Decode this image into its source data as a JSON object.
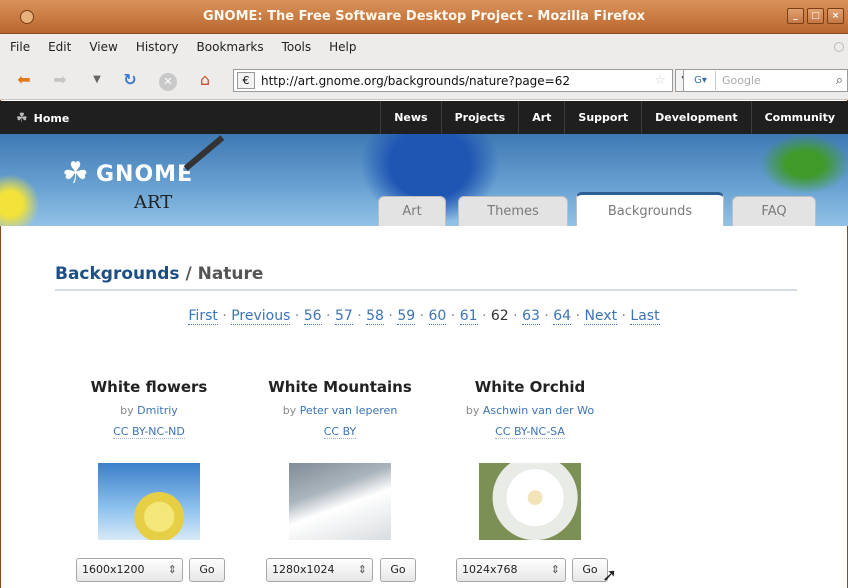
{
  "window": {
    "title": "GNOME: The Free Software Desktop Project - Mozilla Firefox",
    "controls": [
      "_",
      "□",
      "×"
    ]
  },
  "menu": [
    "File",
    "Edit",
    "View",
    "History",
    "Bookmarks",
    "Tools",
    "Help"
  ],
  "toolbar": {
    "url": "http://art.gnome.org/backgrounds/nature?page=62",
    "search_placeholder": "Google"
  },
  "sitenav": {
    "home": "Home",
    "links": [
      "News",
      "Projects",
      "Art",
      "Support",
      "Development",
      "Community"
    ]
  },
  "header": {
    "logo_text": "GNOME",
    "logo_sub": "ART",
    "tabs": [
      "Art",
      "Themes",
      "Backgrounds",
      "FAQ"
    ],
    "active_tab": "Backgrounds"
  },
  "page": {
    "heading": "Backgrounds",
    "subheading": " / Nature"
  },
  "pager": {
    "first": "First",
    "previous": "Previous",
    "pages": [
      "56",
      "57",
      "58",
      "59",
      "60",
      "61",
      "62",
      "63",
      "64"
    ],
    "current": "62",
    "next": "Next",
    "last": "Last",
    "sep": "·"
  },
  "items": [
    {
      "title": "White flowers",
      "by": "by ",
      "author": "Dmitriy",
      "license": "CC BY-NC-ND",
      "resolution": "1600x1200",
      "go": "Go"
    },
    {
      "title": "White Mountains",
      "by": "by ",
      "author": "Peter van Ieperen",
      "license": "CC BY",
      "resolution": "1280x1024",
      "go": "Go"
    },
    {
      "title": "White Orchid",
      "by": "by ",
      "author": "Aschwin van der Wo",
      "license": "CC BY-NC-SA",
      "resolution": "1024x768",
      "go": "Go"
    }
  ]
}
